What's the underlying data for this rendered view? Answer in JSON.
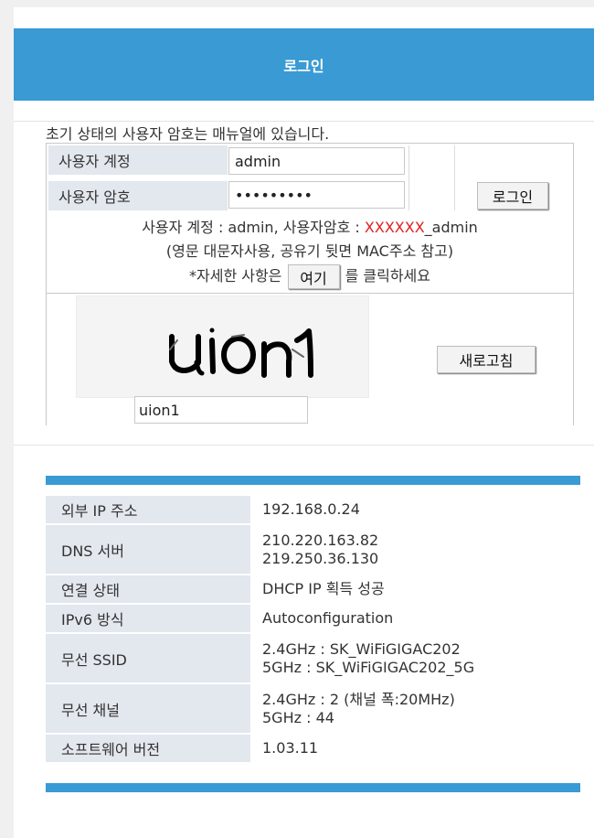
{
  "header": {
    "title": "로그인"
  },
  "login": {
    "notice": "초기 상태의 사용자 암호는 매뉴얼에 있습니다.",
    "account_label": "사용자 계정",
    "account_value": "admin",
    "password_label": "사용자 암호",
    "password_value": "password1",
    "login_button": "로그인",
    "hint_prefix": "사용자 계정 : admin, 사용자암호 : ",
    "hint_masked": "XXXXXX",
    "hint_suffix": "_admin",
    "hint_line2": "(영문 대문자사용, 공유기 뒷면 MAC주소 참고)",
    "detail_prefix": "*자세한 사항은",
    "detail_button": "여기",
    "detail_suffix": "를 클릭하세요"
  },
  "captcha": {
    "image_text": "uion1",
    "input_value": "uion1",
    "refresh_button": "새로고침"
  },
  "status": {
    "rows": [
      {
        "label": "외부 IP 주소",
        "values": [
          "192.168.0.24"
        ]
      },
      {
        "label": "DNS 서버",
        "values": [
          "210.220.163.82",
          "219.250.36.130"
        ]
      },
      {
        "label": "연결 상태",
        "values": [
          "DHCP IP 획득 성공"
        ]
      },
      {
        "label": "IPv6 방식",
        "values": [
          "Autoconfiguration"
        ]
      },
      {
        "label": "무선 SSID",
        "values": [
          "2.4GHz : SK_WiFiGIGAC202",
          "5GHz : SK_WiFiGIGAC202_5G"
        ]
      },
      {
        "label": "무선 채널",
        "values": [
          "2.4GHz : 2 (채널 폭:20MHz)",
          "5GHz : 44"
        ]
      },
      {
        "label": "소프트웨어 버전",
        "values": [
          "1.03.11"
        ]
      }
    ]
  },
  "colors": {
    "accent": "#3a9ad3",
    "label_bg": "#e3e7ee",
    "hint_red": "#e02020"
  }
}
